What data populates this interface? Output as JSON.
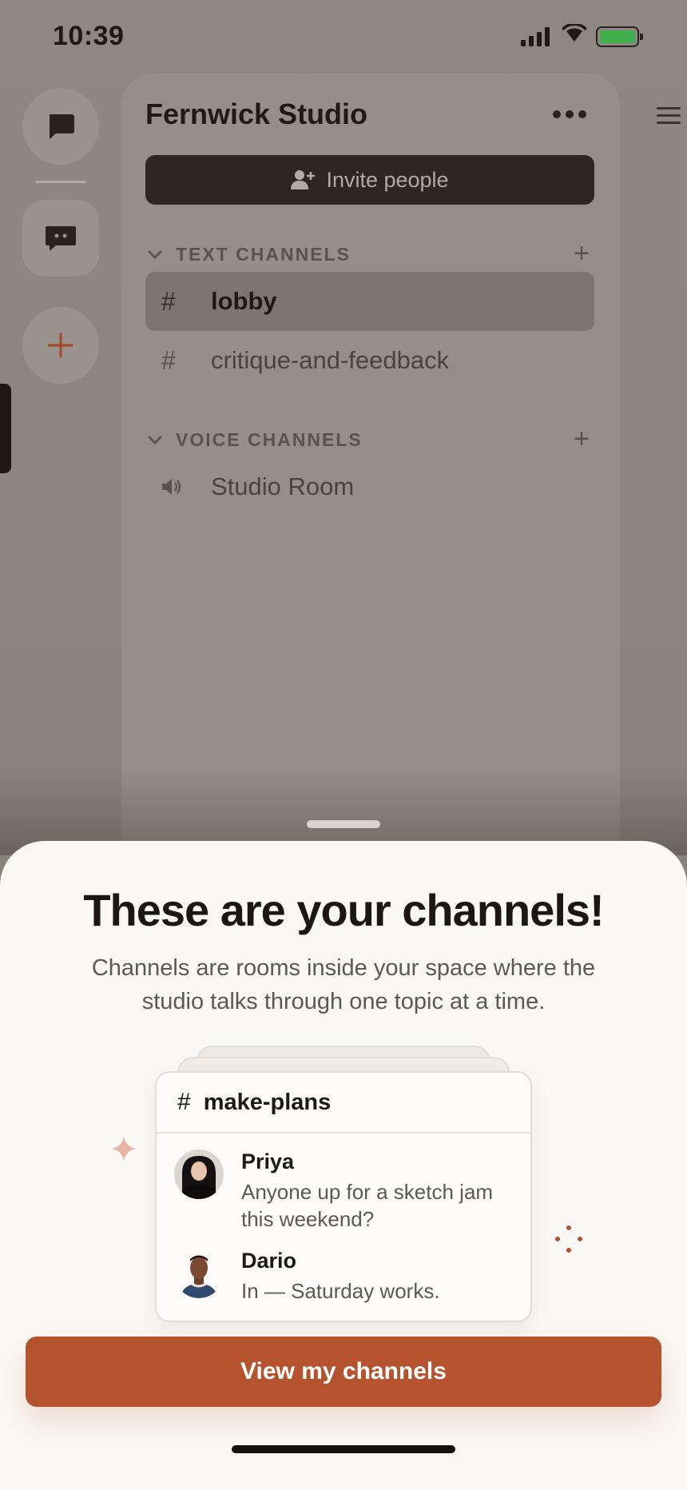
{
  "status_bar": {
    "time": "10:39"
  },
  "server": {
    "name": "Fernwick Studio",
    "invite_label": "Invite people"
  },
  "text_channels": {
    "header": "TEXT CHANNELS",
    "items": [
      {
        "name": "lobby",
        "active": true
      },
      {
        "name": "critique-and-feedback",
        "active": false
      }
    ]
  },
  "voice_channels": {
    "header": "VOICE CHANNELS",
    "items": [
      {
        "name": "Studio Room"
      }
    ]
  },
  "sheet": {
    "title": "These are your channels!",
    "description": "Channels are rooms inside your space where the studio talks through one topic at a time.",
    "preview": {
      "channel": "make-plans",
      "messages": [
        {
          "author": "Priya",
          "text": "Anyone up for a sketch jam this weekend?"
        },
        {
          "author": "Dario",
          "text": "In — Saturday works."
        }
      ]
    },
    "cta_label": "View my channels"
  },
  "colors": {
    "accent": "#b5532f",
    "sheet_bg": "#faf8f5",
    "battery": "#3fae4d"
  },
  "icons": [
    "dm-icon",
    "chat-icon",
    "plus-icon",
    "more-icon",
    "add-person-icon",
    "chevron-down-icon",
    "hash-icon",
    "speaker-icon",
    "hamburger-icon",
    "sparkle-icon"
  ]
}
